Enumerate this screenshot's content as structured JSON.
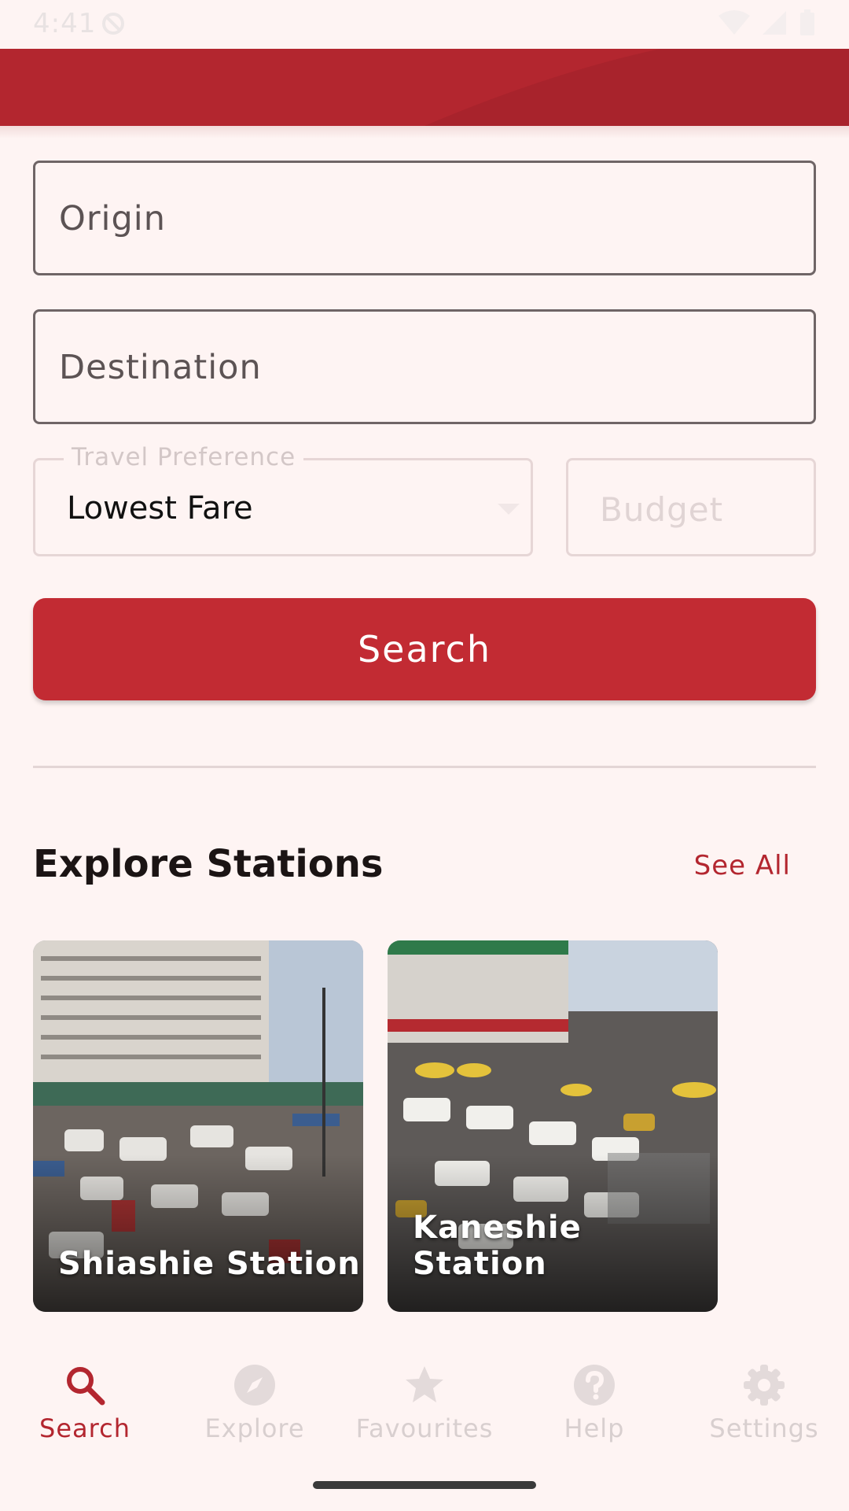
{
  "status_bar": {
    "time": "4:41"
  },
  "form": {
    "origin_placeholder": "Origin",
    "destination_placeholder": "Destination",
    "preference_label": "Travel Preference",
    "preference_value": "Lowest Fare",
    "budget_placeholder": "Budget",
    "search_label": "Search"
  },
  "explore": {
    "title": "Explore Stations",
    "see_all": "See All",
    "stations": [
      {
        "name": "Shiashie Station"
      },
      {
        "name": "Kaneshie Station"
      }
    ]
  },
  "nav": {
    "items": [
      {
        "label": "Search",
        "icon": "search-icon",
        "active": true
      },
      {
        "label": "Explore",
        "icon": "compass-icon",
        "active": false
      },
      {
        "label": "Favourites",
        "icon": "star-icon",
        "active": false
      },
      {
        "label": "Help",
        "icon": "help-icon",
        "active": false
      },
      {
        "label": "Settings",
        "icon": "gear-icon",
        "active": false
      }
    ]
  },
  "colors": {
    "primary": "#b3262f",
    "button": "#c22b33",
    "background": "#fef4f3"
  }
}
